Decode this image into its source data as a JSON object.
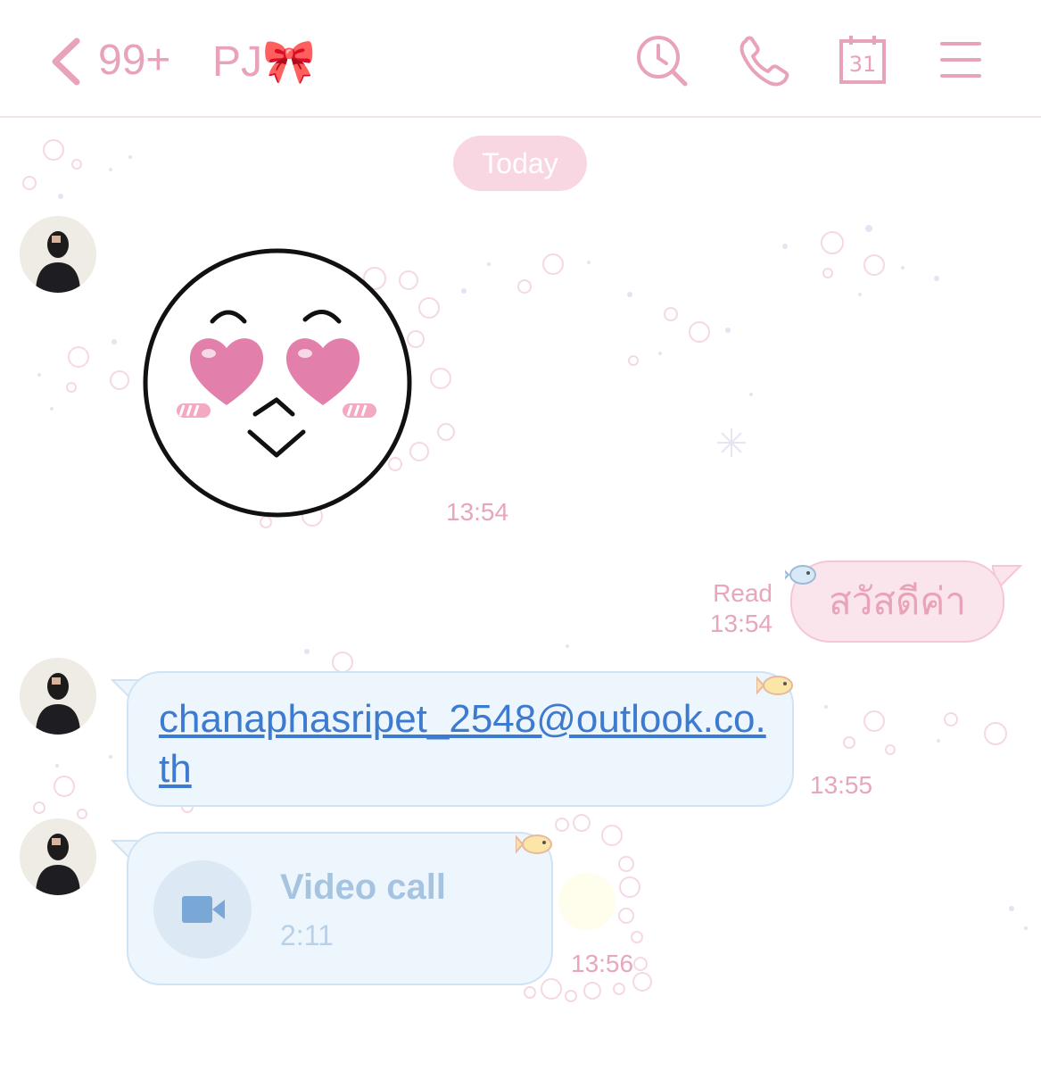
{
  "header": {
    "back_icon": "chevron-left-icon",
    "unread_count": "99+",
    "chat_name": "PJ",
    "name_emoji": "🎀",
    "search_icon": "clock-search-icon",
    "call_icon": "phone-icon",
    "calendar_icon": "calendar-icon",
    "calendar_day": "31",
    "menu_icon": "hamburger-menu-icon",
    "accent_color": "#e9a3b8"
  },
  "chat": {
    "date_label": "Today",
    "messages": [
      {
        "type": "sticker",
        "from": "contact",
        "sticker": "heart-eyes-face",
        "time": "13:54"
      },
      {
        "type": "text",
        "from": "me",
        "text": "สวัสดีค่า",
        "status": "Read",
        "time": "13:54"
      },
      {
        "type": "link",
        "from": "contact",
        "text": "chanaphasripet_2548@outlook.co.th",
        "time": "13:55"
      },
      {
        "type": "video_call",
        "from": "contact",
        "title": "Video call",
        "duration": "2:11",
        "time": "13:56"
      }
    ]
  },
  "colors": {
    "pink_bubble": "#fbe5ec",
    "blue_bubble": "#eef6fd",
    "link": "#3c7bd0",
    "timestamp": "#e7a7ba"
  }
}
